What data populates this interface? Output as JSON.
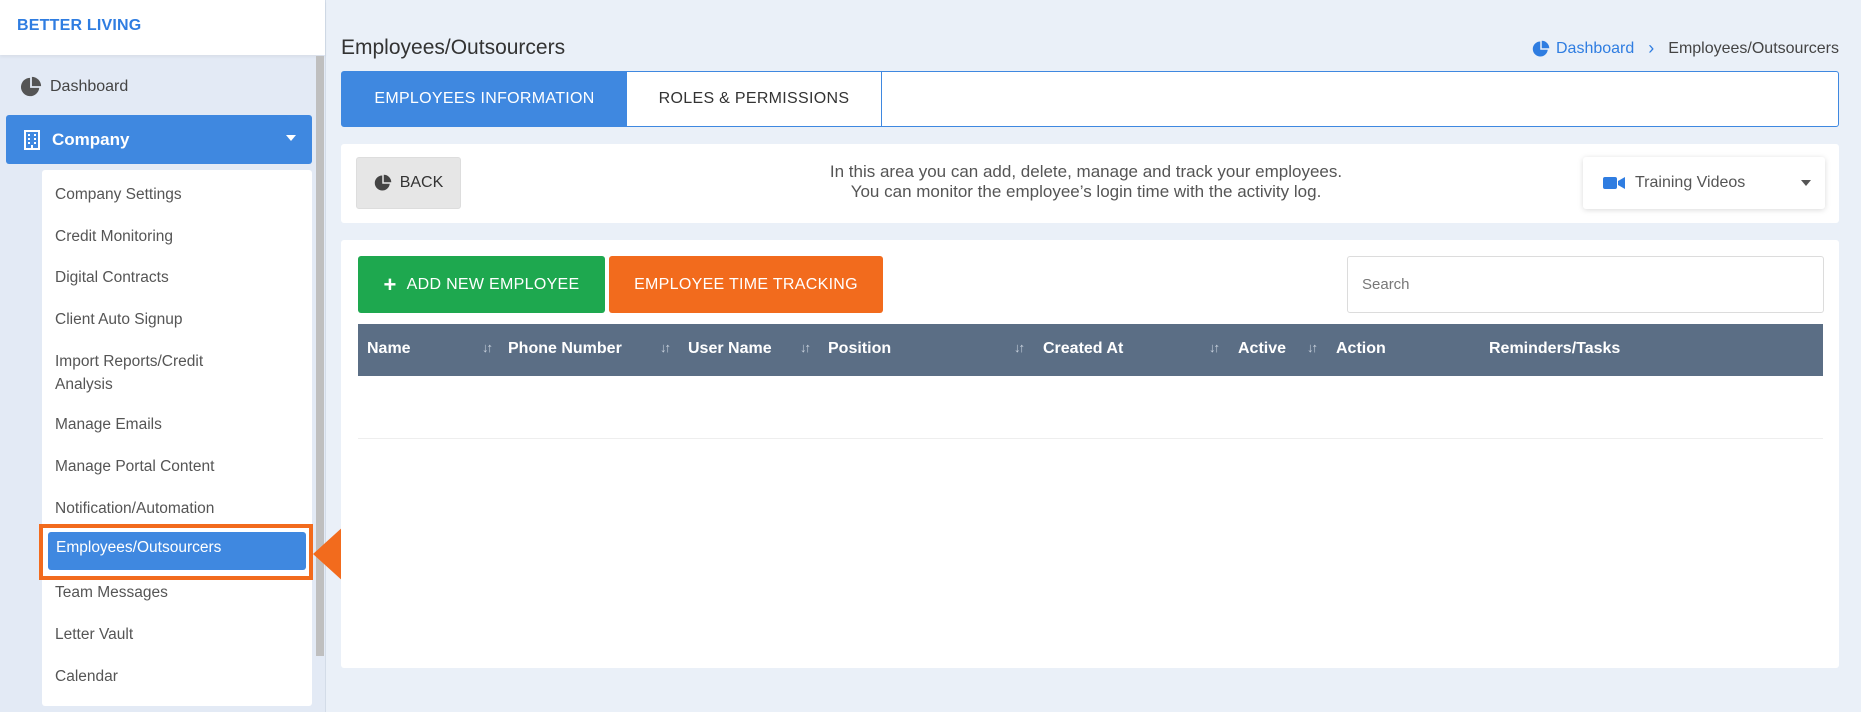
{
  "brand": "BETTER LIVING",
  "sidebar": {
    "dashboard": "Dashboard",
    "company": "Company",
    "submenu": [
      "Company Settings",
      "Credit Monitoring",
      "Digital Contracts",
      "Client Auto Signup",
      "Import Reports/Credit Analysis",
      "Manage Emails",
      "Manage Portal Content",
      "Notification/Automation",
      "Employees/Outsourcers",
      "Team Messages",
      "Letter Vault",
      "Calendar"
    ]
  },
  "page": {
    "title": "Employees/Outsourcers",
    "breadcrumb": {
      "home": "Dashboard",
      "current": "Employees/Outsourcers"
    }
  },
  "tabs": [
    "EMPLOYEES INFORMATION",
    "ROLES & PERMISSIONS"
  ],
  "info": {
    "back": "BACK",
    "line1": "In this area you can add, delete, manage and track your employees.",
    "line2": "You can monitor the employee’s login time with the activity log.",
    "training": "Training Videos"
  },
  "actions": {
    "add": "ADD NEW EMPLOYEE",
    "time": "EMPLOYEE TIME TRACKING",
    "search_placeholder": "Search"
  },
  "table": {
    "columns": [
      "Name",
      "Phone Number",
      "User Name",
      "Position",
      "Created At",
      "Active",
      "Action",
      "Reminders/Tasks"
    ]
  },
  "colors": {
    "primary": "#3f88e0",
    "success": "#1ea84f",
    "orange": "#f26b1d",
    "table_header": "#5b6e85"
  }
}
